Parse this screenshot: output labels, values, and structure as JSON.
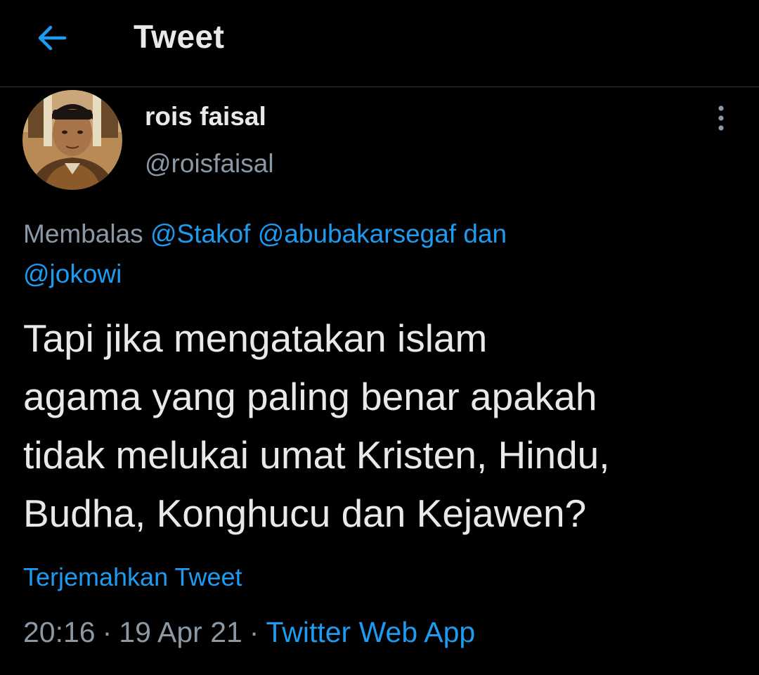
{
  "header": {
    "title": "Tweet",
    "back_icon": "arrow-left-icon",
    "accent_color": "#1d9bf0"
  },
  "tweet": {
    "author": {
      "display_name": "rois faisal",
      "handle": "@roisfaisal",
      "avatar_icon": "avatar"
    },
    "more_icon": "more-vertical-icon",
    "reply_context": {
      "prefix": "Membalas",
      "mentions": [
        "@Stakof",
        "@abubakarsegaf"
      ],
      "conjunction": "dan",
      "last_mention": "@jokowi"
    },
    "text": "Tapi jika mengatakan islam\nagama yang paling benar apakah\ntidak melukai umat Kristen, Hindu,\nBudha, Konghucu dan Kejawen?",
    "translate_label": "Terjemahkan Tweet",
    "time": "20:16",
    "date": "19 Apr 21",
    "separator": "·",
    "source": "Twitter Web App"
  }
}
